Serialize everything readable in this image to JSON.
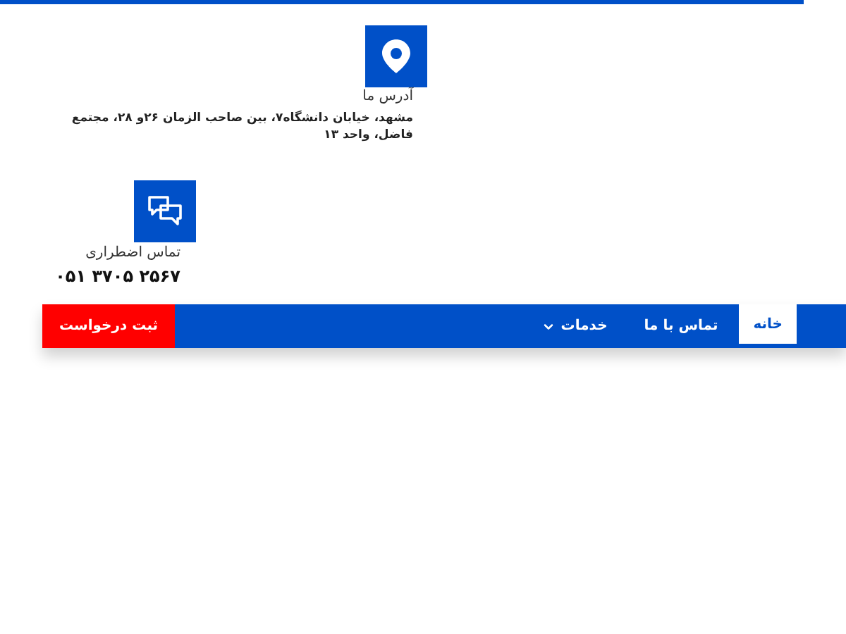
{
  "address": {
    "title": "آدرس ما",
    "text": "مشهد، خیابان دانشگاه۷، بین صاحب الزمان ۲۶و ۲۸، مجتمع فاضل، واحد ۱۳"
  },
  "emergency": {
    "title": "تماس اضطراری",
    "phone": "۰۵۱ ۳۷۰۵ ۲۵۶۷"
  },
  "nav": {
    "items": [
      {
        "label": "خانه",
        "selected": true,
        "has_menu": false
      },
      {
        "label": "تماس با ما",
        "selected": false,
        "has_menu": false
      },
      {
        "label": "خدمات",
        "selected": false,
        "has_menu": true
      }
    ],
    "cta": "ثبت درخواست"
  }
}
